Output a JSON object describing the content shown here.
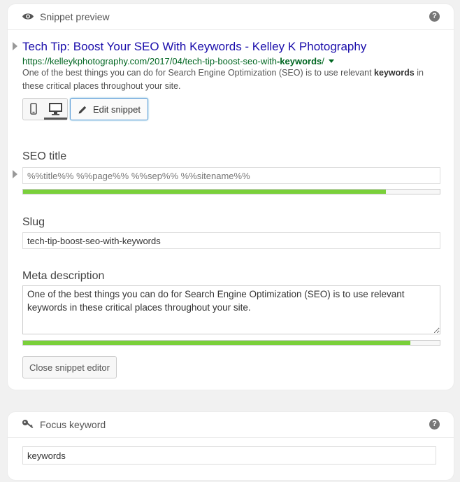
{
  "snippet_panel": {
    "title": "Snippet preview",
    "help_label": "?",
    "icon": "eye-icon"
  },
  "serp": {
    "title": "Tech Tip: Boost Your SEO With Keywords - Kelley K Photography",
    "url_base": "https://kelleykphotography.com/2017/04/tech-tip-boost-seo-with",
    "url_bold": "-keywords",
    "url_end": "/",
    "description_parts": [
      "One of the best things you can do for Search Engine Optimization (SEO) is to use relevant ",
      "keywords",
      " in these critical places throughout your site."
    ]
  },
  "mode_switcher": {
    "mobile_icon": "mobile-icon",
    "desktop_icon": "desktop-icon",
    "active": "desktop"
  },
  "edit_snippet": {
    "label": "Edit snippet",
    "icon": "pencil-icon"
  },
  "seo_title": {
    "label": "SEO title",
    "value": "%%title%% %%page%% %%sep%% %%sitename%%",
    "progress": 0.87
  },
  "slug": {
    "label": "Slug",
    "value": "tech-tip-boost-seo-with-keywords"
  },
  "meta_description": {
    "label": "Meta description",
    "value": "One of the best things you can do for Search Engine Optimization (SEO) is to use relevant keywords in these critical places throughout your site.",
    "progress": 0.93
  },
  "close_editor": {
    "label": "Close snippet editor"
  },
  "focus_panel": {
    "title": "Focus keyword",
    "help_label": "?",
    "icon": "key-icon",
    "value": "keywords"
  },
  "colors": {
    "link_title": "#1a0dab",
    "url_green": "#006621",
    "progress_good": "#7ad03a",
    "focus_blue": "#5b9dd9"
  }
}
